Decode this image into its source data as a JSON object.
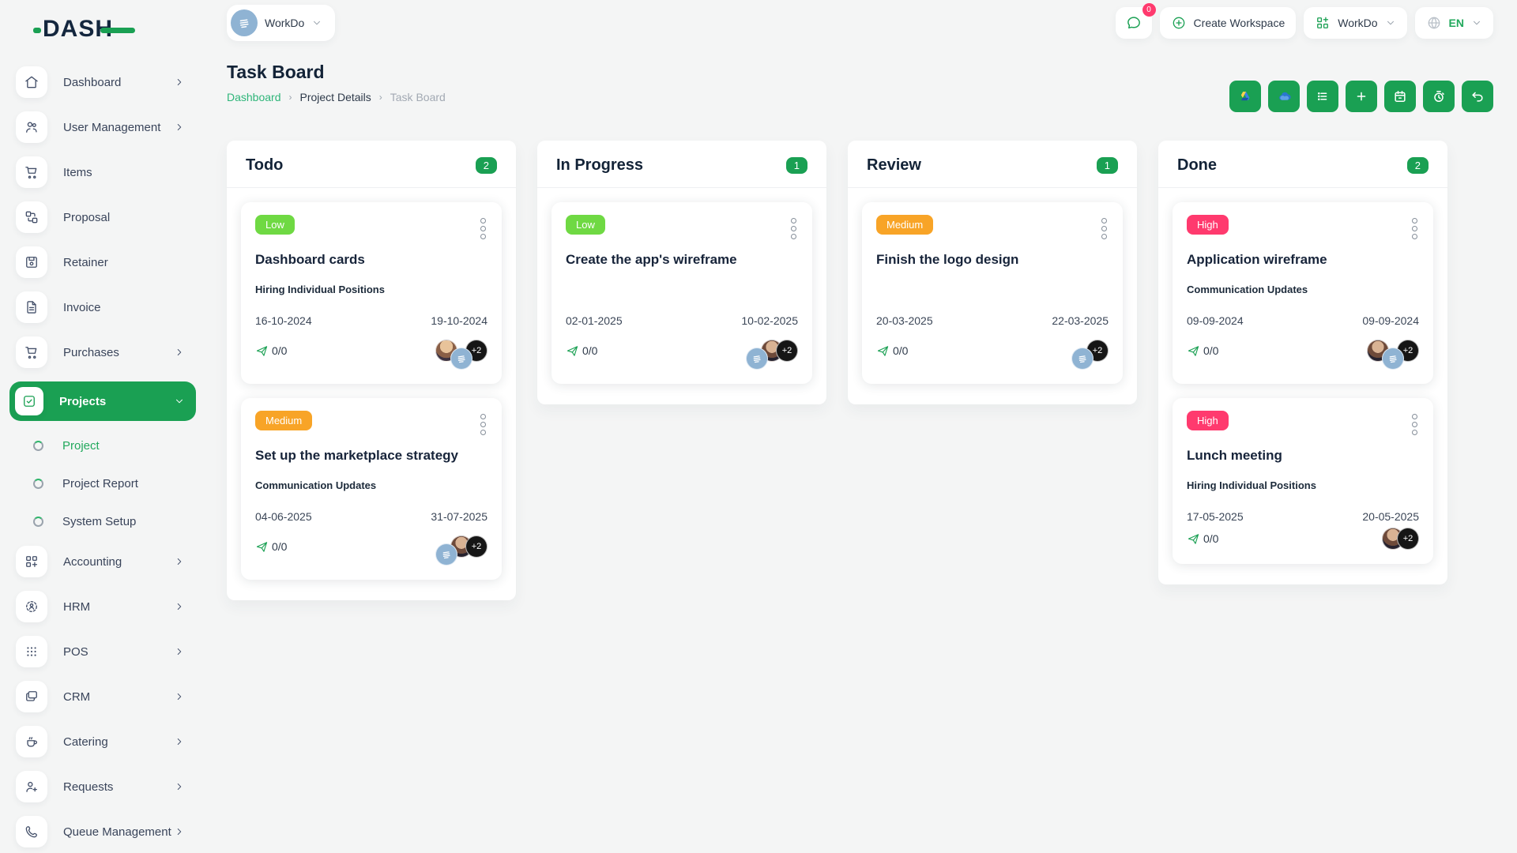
{
  "brand": {
    "name": "DASH"
  },
  "header": {
    "workspace_label": "WorkDo",
    "messages_badge": "0",
    "create_workspace_label": "Create Workspace",
    "app_menu_label": "WorkDo",
    "language_code": "EN"
  },
  "sidebar": {
    "items": [
      {
        "label": "Dashboard"
      },
      {
        "label": "User Management"
      },
      {
        "label": "Items"
      },
      {
        "label": "Proposal"
      },
      {
        "label": "Retainer"
      },
      {
        "label": "Invoice"
      },
      {
        "label": "Purchases"
      },
      {
        "label": "Projects"
      },
      {
        "label": "Accounting"
      },
      {
        "label": "HRM"
      },
      {
        "label": "POS"
      },
      {
        "label": "CRM"
      },
      {
        "label": "Catering"
      },
      {
        "label": "Requests"
      },
      {
        "label": "Queue Management"
      }
    ],
    "project_subitems": [
      {
        "label": "Project"
      },
      {
        "label": "Project Report"
      },
      {
        "label": "System Setup"
      }
    ]
  },
  "page": {
    "title": "Task Board",
    "breadcrumb": [
      "Dashboard",
      "Project Details",
      "Task Board"
    ]
  },
  "toolbar": {
    "buttons": [
      "google-drive",
      "onedrive",
      "list",
      "add",
      "calendar",
      "timer",
      "undo"
    ]
  },
  "board": {
    "columns": [
      {
        "name": "Todo",
        "count": "2",
        "cards": [
          {
            "priority": "Low",
            "title": "Dashboard cards",
            "milestone": "Hiring Individual Positions",
            "start_date": "16-10-2024",
            "end_date": "19-10-2024",
            "progress": "0/0",
            "more": "+2"
          },
          {
            "priority": "Medium",
            "title": "Set up the marketplace strategy",
            "milestone": "Communication Updates",
            "start_date": "04-06-2025",
            "end_date": "31-07-2025",
            "progress": "0/0",
            "more": "+2"
          }
        ]
      },
      {
        "name": "In Progress",
        "count": "1",
        "cards": [
          {
            "priority": "Low",
            "title": "Create the app's wireframe",
            "milestone": "",
            "start_date": "02-01-2025",
            "end_date": "10-02-2025",
            "progress": "0/0",
            "more": "+2"
          }
        ]
      },
      {
        "name": "Review",
        "count": "1",
        "cards": [
          {
            "priority": "Medium",
            "title": "Finish the logo design",
            "milestone": "",
            "start_date": "20-03-2025",
            "end_date": "22-03-2025",
            "progress": "0/0",
            "more": "+2"
          }
        ]
      },
      {
        "name": "Done",
        "count": "2",
        "cards": [
          {
            "priority": "High",
            "title": "Application wireframe",
            "milestone": "Communication Updates",
            "start_date": "09-09-2024",
            "end_date": "09-09-2024",
            "progress": "0/0",
            "more": "+2"
          },
          {
            "priority": "High",
            "title": "Lunch meeting",
            "milestone": "Hiring Individual Positions",
            "start_date": "17-05-2025",
            "end_date": "20-05-2025",
            "progress": "0/0",
            "more": "+2"
          }
        ]
      }
    ]
  },
  "colors": {
    "accent": "#1aa053",
    "low": "#6fd943",
    "medium": "#f8a427",
    "high": "#ff3a6e",
    "notify": "#ff3a6e"
  }
}
